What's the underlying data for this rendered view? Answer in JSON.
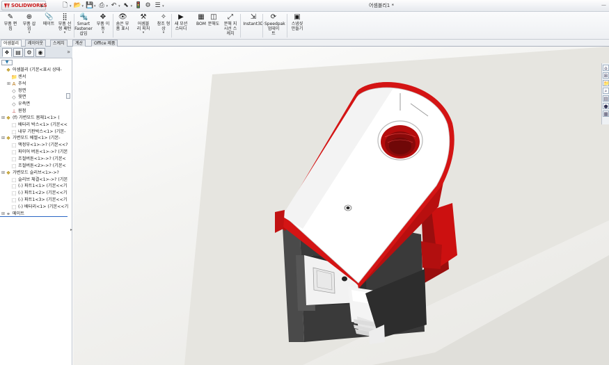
{
  "titlebar": {
    "logo_text": "SOLIDWORKS",
    "document_title": "어셈블리1 *",
    "quick_access": [
      {
        "icon": "new-document-icon",
        "glyph": "🗋",
        "has_dropdown": true
      },
      {
        "icon": "open-folder-icon",
        "glyph": "📂",
        "has_dropdown": true
      },
      {
        "icon": "save-icon",
        "glyph": "💾",
        "has_dropdown": true
      },
      {
        "icon": "print-icon",
        "glyph": "⎙",
        "has_dropdown": true
      },
      {
        "icon": "undo-icon",
        "glyph": "↶",
        "has_dropdown": true
      },
      {
        "icon": "select-pointer-icon",
        "glyph": "⬉",
        "has_dropdown": true
      },
      {
        "icon": "rebuild-icon",
        "glyph": "🚦",
        "has_dropdown": false
      },
      {
        "icon": "options-icon",
        "glyph": "⚙",
        "has_dropdown": false
      },
      {
        "icon": "list-icon",
        "glyph": "☰",
        "has_dropdown": true
      }
    ]
  },
  "command_manager": {
    "buttons": [
      {
        "label": "부품 편\n집",
        "icon": "edit-component-icon",
        "glyph": "✎",
        "dropdown": false
      },
      {
        "label": "부품 삽\n입",
        "icon": "insert-component-icon",
        "glyph": "⊕",
        "dropdown": true
      },
      {
        "label": "메이트",
        "icon": "mate-icon",
        "glyph": "📎",
        "dropdown": false
      },
      {
        "label": "부품 선\n형 패턴",
        "icon": "linear-pattern-icon",
        "glyph": "⣿",
        "dropdown": true
      },
      {
        "label": "Smart\nFastener\n삽입",
        "icon": "smart-fastener-icon",
        "glyph": "🔩",
        "dropdown": false
      },
      {
        "label": "부품 이\n동",
        "icon": "move-component-icon",
        "glyph": "✥",
        "dropdown": true
      },
      {
        "label": "숨은 부\n품 표시",
        "icon": "show-hidden-icon",
        "glyph": "👁",
        "dropdown": false
      },
      {
        "label": "어셈블\n리 피처",
        "icon": "assembly-feature-icon",
        "glyph": "⚒",
        "dropdown": true
      },
      {
        "label": "참조 형\n상",
        "icon": "reference-geometry-icon",
        "glyph": "✧",
        "dropdown": true
      },
      {
        "label": "새 모션\n스터디",
        "icon": "motion-study-icon",
        "glyph": "▶",
        "dropdown": false
      },
      {
        "label": "BOM",
        "icon": "bom-icon",
        "glyph": "▦",
        "dropdown": false
      },
      {
        "label": "분해도",
        "icon": "exploded-view-icon",
        "glyph": "◫",
        "dropdown": false
      },
      {
        "label": "분해 지\n시선 스\n케치",
        "icon": "explode-line-sketch-icon",
        "glyph": "⤢",
        "dropdown": false
      },
      {
        "label": "Instant3D",
        "icon": "instant3d-icon",
        "glyph": "⇲",
        "dropdown": false
      },
      {
        "label": "Speedpak\n업데이\n트",
        "icon": "speedpak-icon",
        "glyph": "⟳",
        "dropdown": false
      },
      {
        "label": "스냅샷\n만들기",
        "icon": "snapshot-icon",
        "glyph": "▣",
        "dropdown": false
      }
    ]
  },
  "tabs": [
    "어셈블리",
    "레이아웃",
    "스케치",
    "계산",
    "Office 제품"
  ],
  "active_tab": "어셈블리",
  "feature_manager": {
    "panel_tabs": [
      {
        "icon": "feature-tree-tab-icon",
        "glyph": "❖"
      },
      {
        "icon": "property-manager-tab-icon",
        "glyph": "▤"
      },
      {
        "icon": "configuration-manager-tab-icon",
        "glyph": "⚙"
      },
      {
        "icon": "display-manager-tab-icon",
        "glyph": "◉"
      }
    ],
    "more_glyph": "»",
    "filter_glyph": "▼",
    "tree": [
      {
        "label": "어셈블리 (기본<표시 상태-",
        "icon": "assembly-icon",
        "glyph": "❖",
        "expand": "",
        "indent": 0,
        "color": "#b38a00"
      },
      {
        "label": "센서",
        "icon": "sensor-icon",
        "glyph": "📁",
        "expand": "",
        "indent": 1,
        "color": "#c28a00"
      },
      {
        "label": "주석",
        "icon": "annotation-icon",
        "glyph": "A",
        "expand": "⊞",
        "indent": 1,
        "color": "#b06a00"
      },
      {
        "label": "정면",
        "icon": "plane-icon",
        "glyph": "◇",
        "expand": "",
        "indent": 1,
        "color": "#555555"
      },
      {
        "label": "윗면",
        "icon": "plane-icon",
        "glyph": "◇",
        "expand": "",
        "indent": 1,
        "color": "#555555"
      },
      {
        "label": "우측면",
        "icon": "plane-icon",
        "glyph": "◇",
        "expand": "",
        "indent": 1,
        "color": "#555555"
      },
      {
        "label": "원점",
        "icon": "origin-icon",
        "glyph": "⊥",
        "expand": "",
        "indent": 1,
        "color": "#b02020"
      },
      {
        "label": "(f) 가변모드 몸체1<1> (",
        "icon": "subassembly-icon",
        "glyph": "❖",
        "expand": "⊞",
        "indent": 0,
        "color": "#b38a00"
      },
      {
        "label": "배터리 박스<1> (기본<<",
        "icon": "part-icon",
        "glyph": "⬚",
        "expand": "",
        "indent": 1,
        "color": "#555555"
      },
      {
        "label": "내부 기판박스<1> (기본-",
        "icon": "part-icon",
        "glyph": "⬚",
        "expand": "",
        "indent": 1,
        "color": "#555555"
      },
      {
        "label": "가변모드 베젤<1> (기본-",
        "icon": "subassembly-icon",
        "glyph": "❖",
        "expand": "⊞",
        "indent": 0,
        "color": "#b38a00"
      },
      {
        "label": "액정부<1>->? (기본<<?",
        "icon": "part-icon",
        "glyph": "⬚",
        "expand": "",
        "indent": 1,
        "color": "#555555"
      },
      {
        "label": "파이어 버튼<1>->? (기본",
        "icon": "part-icon",
        "glyph": "⬚",
        "expand": "",
        "indent": 1,
        "color": "#555555"
      },
      {
        "label": "조절버튼<1>->? (기본<",
        "icon": "part-icon",
        "glyph": "⬚",
        "expand": "",
        "indent": 1,
        "color": "#555555"
      },
      {
        "label": "조절버튼<2>->? (기본<",
        "icon": "part-icon",
        "glyph": "⬚",
        "expand": "",
        "indent": 1,
        "color": "#555555"
      },
      {
        "label": "가변모드 슬리브<1>->?",
        "icon": "subassembly-icon",
        "glyph": "❖",
        "expand": "⊞",
        "indent": 0,
        "color": "#b38a00"
      },
      {
        "label": "슬리브 체결<1>->? (기본",
        "icon": "part-icon",
        "glyph": "⬚",
        "expand": "",
        "indent": 1,
        "color": "#555555"
      },
      {
        "label": "(-) 파트1<1> (기본<<기",
        "icon": "part-icon",
        "glyph": "⬚",
        "expand": "",
        "indent": 1,
        "color": "#555555"
      },
      {
        "label": "(-) 파트1<2> (기본<<기",
        "icon": "part-icon",
        "glyph": "⬚",
        "expand": "",
        "indent": 1,
        "color": "#555555"
      },
      {
        "label": "(-) 파트1<3> (기본<<기",
        "icon": "part-icon",
        "glyph": "⬚",
        "expand": "",
        "indent": 1,
        "color": "#555555"
      },
      {
        "label": "(-) 배터리<1> (기본<<기",
        "icon": "part-icon",
        "glyph": "⬚",
        "expand": "",
        "indent": 1,
        "color": "#555555"
      },
      {
        "label": "메이트",
        "icon": "mates-folder-icon",
        "glyph": "⚭",
        "expand": "⊞",
        "indent": 0,
        "color": "#555555"
      }
    ]
  },
  "graphics": {
    "headsup_icons": [
      {
        "icon": "zoom-to-fit-icon",
        "glyph": "⊕"
      },
      {
        "icon": "zoom-area-icon",
        "glyph": "⊙"
      },
      {
        "icon": "previous-view-icon",
        "glyph": "↺"
      },
      {
        "icon": "section-view-icon",
        "glyph": "◪"
      },
      {
        "icon": "view-orientation-icon",
        "glyph": "▣"
      },
      {
        "icon": "display-style-icon",
        "glyph": "◧"
      },
      {
        "icon": "hide-show-items-icon",
        "glyph": "◔"
      },
      {
        "icon": "edit-appearance-icon",
        "glyph": "●"
      },
      {
        "icon": "apply-scene-icon",
        "glyph": "◐"
      },
      {
        "icon": "view-settings-icon",
        "glyph": "▤"
      }
    ],
    "view_buttons": "□□ _ □ ✕",
    "accent_red": "#cc1010",
    "body_gray": "#3a3a3a",
    "task_pane": [
      {
        "icon": "solidworks-resources-icon",
        "glyph": "⌂"
      },
      {
        "icon": "design-library-icon",
        "glyph": "⊞"
      },
      {
        "icon": "file-explorer-icon",
        "glyph": "📁"
      },
      {
        "icon": "search-icon",
        "glyph": "⌕"
      },
      {
        "icon": "view-palette-icon",
        "glyph": "▤"
      },
      {
        "icon": "appearances-icon",
        "glyph": "●"
      },
      {
        "icon": "custom-properties-icon",
        "glyph": "▦"
      }
    ]
  }
}
